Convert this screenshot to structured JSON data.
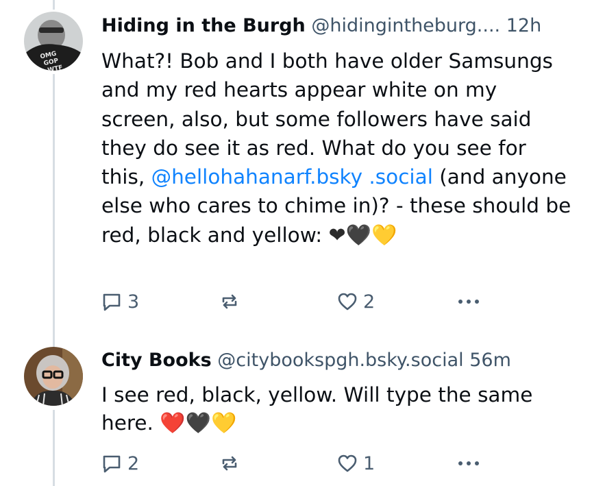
{
  "posts": [
    {
      "display_name": "Hiding in the Burgh",
      "handle": "@hidingintheburg....",
      "timestamp": "12h",
      "avatar_text": [
        "OMG",
        "GOP",
        "WTF"
      ],
      "text_before_mention": "What?! Bob and I both have older Samsungs and my red hearts appear white on my screen, also, but some followers have said they do see it as red. What do you see for this, ",
      "mention": "@hellohahanarf.bsky .social",
      "text_after_mention": " (and anyone else who cares to chime in)? - these should be red, black and yellow: ",
      "emojis": [
        "❤",
        "🖤",
        "💛"
      ],
      "reply_count": "3",
      "like_count": "2"
    },
    {
      "display_name": "City Books",
      "handle": "@citybookspgh.bsky.social",
      "timestamp": "56m",
      "text": "I see red, black, yellow. Will type the same here. ",
      "emojis": [
        "❤️",
        "🖤",
        "💛"
      ],
      "reply_count": "2",
      "like_count": "1"
    }
  ],
  "colors": {
    "accent_link": "#1083fe",
    "meta_text": "#3f5468",
    "thread_line": "#d7dde3"
  },
  "icons": [
    "reply-icon",
    "repost-icon",
    "like-icon",
    "more-icon"
  ]
}
